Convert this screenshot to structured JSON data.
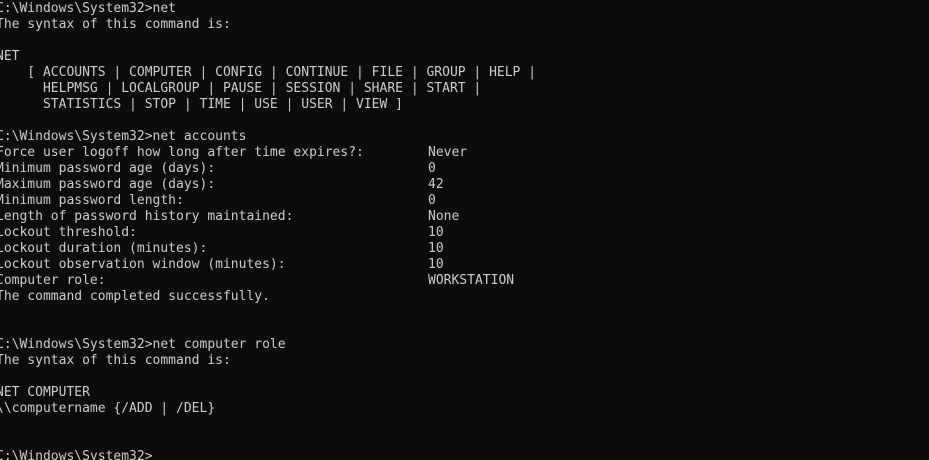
{
  "lines": {
    "l1": "C:\\Windows\\System32>net",
    "l2": "The syntax of this command is:",
    "l3": "",
    "l4": "NET",
    "l5": "    [ ACCOUNTS | COMPUTER | CONFIG | CONTINUE | FILE | GROUP | HELP |",
    "l6": "      HELPMSG | LOCALGROUP | PAUSE | SESSION | SHARE | START |",
    "l7": "      STATISTICS | STOP | TIME | USE | USER | VIEW ]",
    "l8": "",
    "l9": "C:\\Windows\\System32>net accounts"
  },
  "accounts": {
    "rows": [
      {
        "label": "Force user logoff how long after time expires?:",
        "value": "Never"
      },
      {
        "label": "Minimum password age (days):",
        "value": "0"
      },
      {
        "label": "Maximum password age (days):",
        "value": "42"
      },
      {
        "label": "Minimum password length:",
        "value": "0"
      },
      {
        "label": "Length of password history maintained:",
        "value": "None"
      },
      {
        "label": "Lockout threshold:",
        "value": "10"
      },
      {
        "label": "Lockout duration (minutes):",
        "value": "10"
      },
      {
        "label": "Lockout observation window (minutes):",
        "value": "10"
      },
      {
        "label": "Computer role:",
        "value": "WORKSTATION"
      }
    ]
  },
  "tail": {
    "l19": "The command completed successfully.",
    "l20": "",
    "l21": "",
    "l22": "C:\\Windows\\System32>net computer role",
    "l23": "The syntax of this command is:",
    "l24": "",
    "l25": "NET COMPUTER",
    "l26": "\\\\computername {/ADD | /DEL}",
    "l27": "",
    "l28": "",
    "l29": "C:\\Windows\\System32>"
  }
}
